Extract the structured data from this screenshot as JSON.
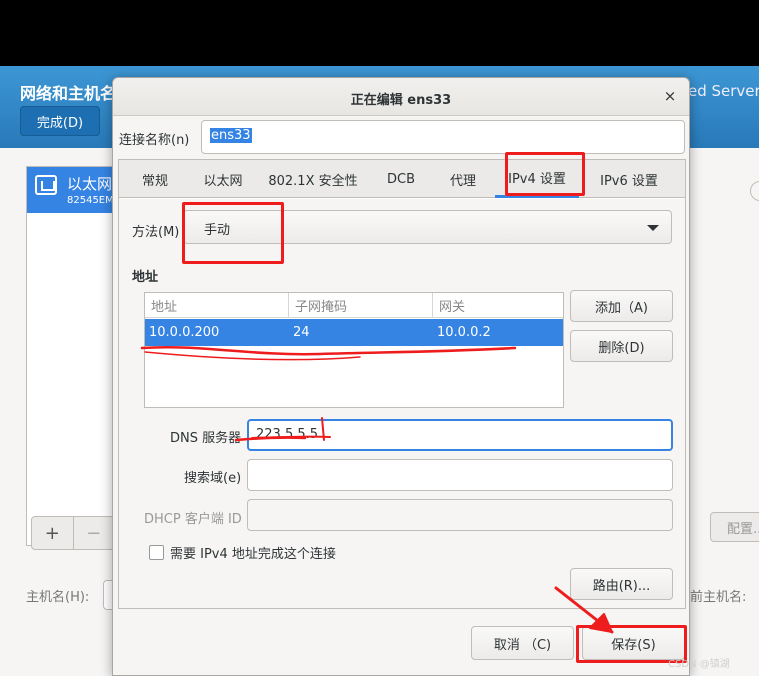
{
  "background": {
    "title": "网络和主机名",
    "done_button": "完成(D)",
    "server_text": "ed Server",
    "list_item_name": "以太网",
    "list_item_sub": "82545EM",
    "add_symbol": "+",
    "remove_symbol": "−",
    "config_button": "配置...",
    "hostname_label": "主机名(H):",
    "current_hostname_label": "前主机名:"
  },
  "dialog": {
    "title": "正在编辑 ens33",
    "close_symbol": "×",
    "connection_name_label": "连接名称(n)",
    "connection_name_value": "ens33",
    "tabs": [
      "常规",
      "以太网",
      "802.1X 安全性",
      "DCB",
      "代理",
      "IPv4 设置",
      "IPv6 设置"
    ],
    "active_tab": "IPv4 设置",
    "method_label": "方法(M)",
    "method_value": "手动",
    "address_heading": "地址",
    "address_columns": [
      "地址",
      "子网掩码",
      "网关"
    ],
    "address_rows": [
      {
        "address": "10.0.0.200",
        "netmask": "24",
        "gateway": "10.0.0.2"
      }
    ],
    "add_button": "添加（A)",
    "delete_button": "删除(D)",
    "dns_label": "DNS 服务器",
    "dns_value": "223.5.5.5",
    "search_label": "搜索域(e)",
    "search_value": "",
    "dhcp_label": "DHCP 客户端 ID",
    "dhcp_value": "",
    "require_ipv4_label": "需要 IPv4 地址完成这个连接",
    "routes_button": "路由(R)...",
    "cancel_button": "取消 （C)",
    "save_button": "保存(S)"
  },
  "watermark": "CSDN @镇湖",
  "colors": {
    "accent": "#3584e4",
    "annotation_red": "#ee1c1c",
    "header_blue": "#2b89c8"
  }
}
